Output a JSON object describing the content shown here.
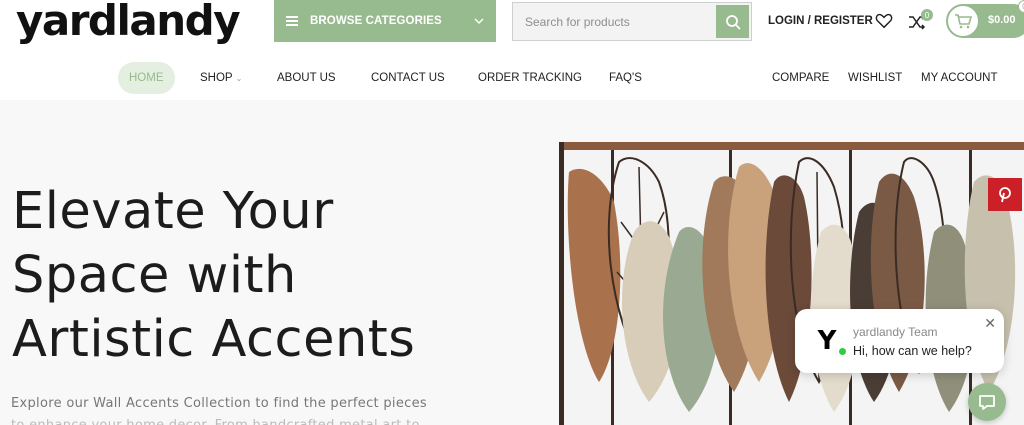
{
  "header": {
    "logo": "yardlandy",
    "browse_label": "BROWSE CATEGORIES",
    "search_placeholder": "Search for products",
    "login_label": "LOGIN / REGISTER",
    "compare_count": "0",
    "cart_amount": "$0.00",
    "cart_count": "0"
  },
  "nav": {
    "items": [
      "HOME",
      "SHOP",
      "ABOUT US",
      "CONTACT US",
      "ORDER TRACKING",
      "FAQ'S"
    ],
    "right_items": [
      "COMPARE",
      "WISHLIST",
      "MY ACCOUNT"
    ]
  },
  "hero": {
    "headline_line1": "Elevate Your",
    "headline_line2": "Space with",
    "headline_line3": "Artistic Accents",
    "subtext_line1": "Explore our Wall Accents Collection to find the perfect pieces",
    "subtext_line2": "to enhance your home decor. From handcrafted metal art to"
  },
  "chat": {
    "team_name": "yardlandy Team",
    "message": "Hi, how can we help?",
    "avatar_letter": "Y"
  },
  "colors": {
    "accent": "#98ba8f",
    "pinterest": "#cb2027",
    "hero_bg": "#f8f8f8"
  },
  "icons": {
    "browse": "hamburger-icon",
    "search": "search-icon",
    "wishlist": "heart-icon",
    "compare": "shuffle-icon",
    "cart": "cart-icon",
    "share": "pinterest-icon",
    "chat": "chat-bubble-icon"
  }
}
